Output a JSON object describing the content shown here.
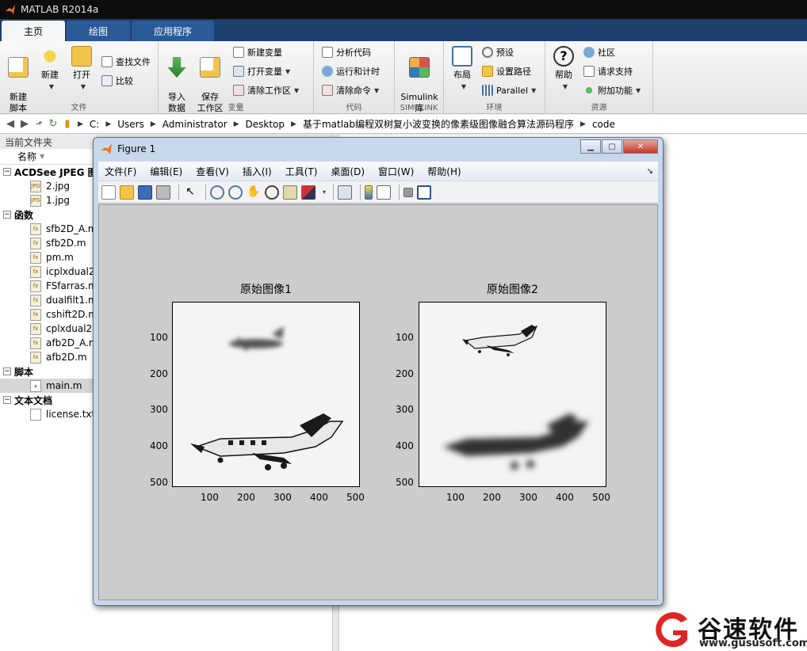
{
  "app": {
    "title": "MATLAB R2014a"
  },
  "ribbon": {
    "tabs": [
      "主页",
      "绘图",
      "应用程序"
    ],
    "groups": {
      "file": {
        "label": "文件",
        "new_script": "新建\n脚本",
        "new": "新建",
        "open": "打开",
        "find_files": "查找文件",
        "compare": "比较"
      },
      "variable": {
        "label": "变量",
        "import": "导入\n数据",
        "save_workspace": "保存\n工作区",
        "new_variable": "新建变量",
        "open_variable": "打开变量",
        "clear_workspace": "清除工作区"
      },
      "code": {
        "label": "代码",
        "analyze": "分析代码",
        "run_time": "运行和计时",
        "clear_commands": "清除命令"
      },
      "simulink": {
        "label": "SIMULINK",
        "btn": "Simulink\n库"
      },
      "environment": {
        "label": "环境",
        "layout": "布局",
        "preferences": "预设",
        "set_path": "设置路径",
        "parallel": "Parallel"
      },
      "resources": {
        "label": "资源",
        "help": "帮助",
        "community": "社区",
        "support": "请求支持",
        "addons": "附加功能"
      }
    }
  },
  "address": {
    "crumbs": [
      "C:",
      "Users",
      "Administrator",
      "Desktop",
      "基于matlab编程双树复小波变换的像素级图像融合算法源码程序",
      "code"
    ]
  },
  "filepanel": {
    "title": "当前文件夹",
    "header": "名称",
    "groups": [
      {
        "name": "ACDSee JPEG 图",
        "items": [
          "2.jpg",
          "1.jpg"
        ],
        "icon": "jpg"
      },
      {
        "name": "函数",
        "items": [
          "sfb2D_A.m",
          "sfb2D.m",
          "pm.m",
          "icplxdual2D",
          "FSfarras.m",
          "dualfilt1.m",
          "cshift2D.m",
          "cplxdual2D",
          "afb2D_A.m",
          "afb2D.m"
        ],
        "icon": "func"
      },
      {
        "name": "脚本",
        "items": [
          "main.m"
        ],
        "icon": "script"
      },
      {
        "name": "文本文档",
        "items": [
          "license.txt"
        ],
        "icon": "txt"
      }
    ],
    "selected": "main.m"
  },
  "figure": {
    "title": "Figure 1",
    "menus": [
      "文件(F)",
      "编辑(E)",
      "查看(V)",
      "插入(I)",
      "工具(T)",
      "桌面(D)",
      "窗口(W)",
      "帮助(H)"
    ],
    "axes": [
      {
        "title": "原始图像1",
        "yticks": [
          "100",
          "200",
          "300",
          "400",
          "500"
        ],
        "xticks": [
          "100",
          "200",
          "300",
          "400",
          "500"
        ]
      },
      {
        "title": "原始图像2",
        "yticks": [
          "100",
          "200",
          "300",
          "400",
          "500"
        ],
        "xticks": [
          "100",
          "200",
          "300",
          "400",
          "500"
        ]
      }
    ]
  },
  "watermark": {
    "name": "谷速软件",
    "url": "www.gususoft.com"
  }
}
